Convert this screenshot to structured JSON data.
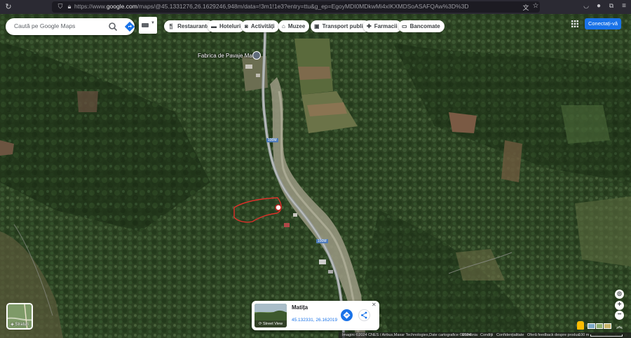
{
  "browser": {
    "url_prefix": "https://www.",
    "url_domain": "google.com",
    "url_rest": "/maps/@45.1331276,26.1629246,948m/data=!3m1!1e3?entry=ttu&g_ep=EgoyMDI0MDkwMi4xIKXMDSoASAFQAw%3D%3D"
  },
  "search": {
    "placeholder": "Caută pe Google Maps"
  },
  "chips": [
    {
      "icon": "fork-knife-icon",
      "label": "Restaurante"
    },
    {
      "icon": "bed-icon",
      "label": "Hoteluri"
    },
    {
      "icon": "camera-icon",
      "label": "Activități"
    },
    {
      "icon": "museum-icon",
      "label": "Muzee"
    },
    {
      "icon": "bus-icon",
      "label": "Transport public"
    },
    {
      "icon": "pharmacy-icon",
      "label": "Farmacii"
    },
    {
      "icon": "atm-icon",
      "label": "Bancomate"
    }
  ],
  "signin_label": "Conectați-vă",
  "map": {
    "poi_label": "Fabrica de Pavaje Matita",
    "road_label_1": "100M",
    "road_label_2": "100M",
    "layers_label": "Straturi"
  },
  "card": {
    "title": "Matița",
    "coords": "45.132331, 26.162019",
    "thumb_label": "Street View"
  },
  "footer": {
    "imagery": "Imagini ©2024 CNES / Airbus,Maxar Technologies,Date cartografice ©2024",
    "region": "România",
    "terms": "Condiții",
    "privacy": "Confidențialitate",
    "feedback": "Oferă feedback despre produs",
    "scale": "100 m"
  },
  "colors": {
    "accent": "#1a73e8",
    "forest": "#2f4626"
  }
}
